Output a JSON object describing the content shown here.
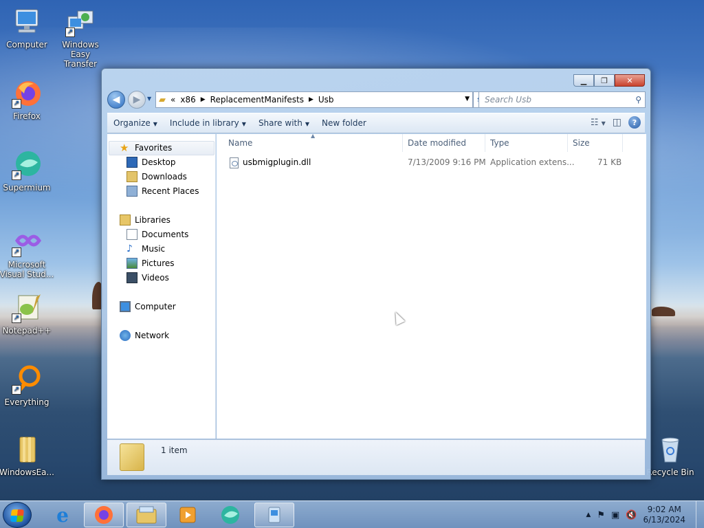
{
  "desktop": {
    "icons": [
      {
        "label": "Computer"
      },
      {
        "label": "Windows Easy Transfer"
      },
      {
        "label": "Firefox"
      },
      {
        "label": "Supermium"
      },
      {
        "label": "Microsoft Visual Stud..."
      },
      {
        "label": "Notepad++"
      },
      {
        "label": "Everything"
      },
      {
        "label": "WindowsEa..."
      },
      {
        "label": "Recycle Bin"
      }
    ]
  },
  "window": {
    "address": {
      "overflow": "«",
      "segments": [
        "x86",
        "ReplacementManifests",
        "Usb"
      ]
    },
    "search_placeholder": "Search Usb",
    "toolbar": {
      "organize": "Organize",
      "include_in_library": "Include in library",
      "share_with": "Share with",
      "new_folder": "New folder"
    },
    "nav": {
      "favorites": "Favorites",
      "desktop": "Desktop",
      "downloads": "Downloads",
      "recent_places": "Recent Places",
      "libraries": "Libraries",
      "documents": "Documents",
      "music": "Music",
      "pictures": "Pictures",
      "videos": "Videos",
      "computer": "Computer",
      "network": "Network"
    },
    "columns": {
      "name": "Name",
      "date_modified": "Date modified",
      "type": "Type",
      "size": "Size"
    },
    "files": [
      {
        "name": "usbmigplugin.dll",
        "date": "7/13/2009 9:16 PM",
        "type": "Application extens...",
        "size": "71 KB"
      }
    ],
    "status": "1 item"
  },
  "taskbar": {
    "time": "9:02 AM",
    "date": "6/13/2024"
  }
}
